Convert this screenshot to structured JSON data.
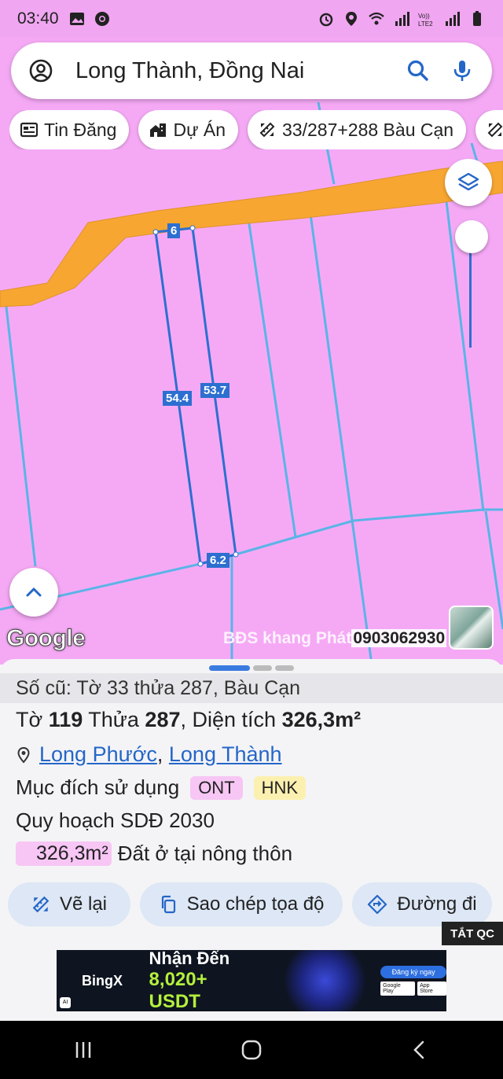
{
  "status_bar": {
    "time": "03:40"
  },
  "search": {
    "query": "Long Thành, Đồng Nai"
  },
  "chips": [
    {
      "label": "Tin Đăng",
      "icon": "news-icon"
    },
    {
      "label": "Dự Án",
      "icon": "building-icon"
    },
    {
      "label": "33/287+288 Bàu Cạn",
      "icon": "measure-icon"
    }
  ],
  "map": {
    "measurements": {
      "top": "6",
      "left": "54.4",
      "right": "53.7",
      "bottom": "6.2"
    },
    "attribution": "Google",
    "watermark_name": "BĐS khang Phát",
    "watermark_phone": "0903062930",
    "colors": {
      "land": "#f5a9f5",
      "road": "#f7a632",
      "boundary": "#5ab4e6",
      "parcel": "#2d6fd0"
    }
  },
  "sheet": {
    "old_label": "Số cũ: Tờ 33 thửa 287, Bàu Cạn",
    "parcel": {
      "sheet_label": "Tờ",
      "sheet_no": "119",
      "lot_label": "Thửa",
      "lot_no": "287",
      "area_label": "Diện tích",
      "area": "326,3m²"
    },
    "location": {
      "ward": "Long Phước",
      "district": "Long Thành"
    },
    "purpose_label": "Mục đích sử dụng",
    "tags": [
      "ONT",
      "HNK"
    ],
    "plan_title": "Quy hoạch SDĐ 2030",
    "plan_area": "326,3m²",
    "plan_desc": "Đất ở tại nông thôn",
    "actions": {
      "redraw": "Vẽ lại",
      "copy": "Sao chép tọa độ",
      "directions": "Đường đi"
    },
    "ads_off": "TẮT QC"
  },
  "ad": {
    "brand": "BingX",
    "headline": "Nhận Đến",
    "amount": "8,020+ USDT",
    "cta": "Đăng ký ngay",
    "store1": "Google Play",
    "store2": "App Store"
  }
}
